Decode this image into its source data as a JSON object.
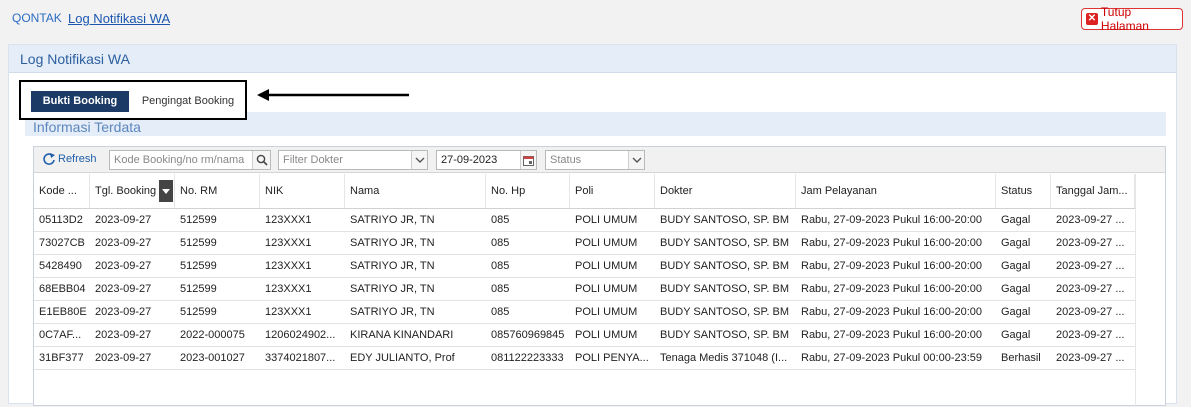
{
  "breadcrumb": {
    "app": "QONTAK",
    "page": "Log Notifikasi WA"
  },
  "close_button": {
    "label": "Tutup Halaman"
  },
  "panel": {
    "title": "Log Notifikasi WA"
  },
  "tabs": [
    {
      "label": "Bukti Booking",
      "active": true
    },
    {
      "label": "Pengingat Booking",
      "active": false
    }
  ],
  "section": {
    "title": "Informasi Terdata"
  },
  "toolbar": {
    "refresh_label": "Refresh",
    "search_placeholder": "Kode Booking/no rm/nama",
    "doctor_placeholder": "Filter Dokter",
    "date_value": "27-09-2023",
    "status_placeholder": "Status"
  },
  "columns": [
    "Kode ...",
    "Tgl. Booking",
    "No. RM",
    "NIK",
    "Nama",
    "No. Hp",
    "Poli",
    "Dokter",
    "Jam Pelayanan",
    "Status",
    "Tanggal Jam..."
  ],
  "rows": [
    [
      "05113D2",
      "2023-09-27",
      "512599",
      "123XXX1",
      "SATRIYO JR, TN",
      "085",
      "POLI UMUM",
      "BUDY SANTOSO, SP. BM",
      "Rabu, 27-09-2023 Pukul 16:00-20:00",
      "Gagal",
      "2023-09-27 ..."
    ],
    [
      "73027CB",
      "2023-09-27",
      "512599",
      "123XXX1",
      "SATRIYO JR, TN",
      "085",
      "POLI UMUM",
      "BUDY SANTOSO, SP. BM",
      "Rabu, 27-09-2023 Pukul 16:00-20:00",
      "Gagal",
      "2023-09-27 ..."
    ],
    [
      "5428490",
      "2023-09-27",
      "512599",
      "123XXX1",
      "SATRIYO JR, TN",
      "085",
      "POLI UMUM",
      "BUDY SANTOSO, SP. BM",
      "Rabu, 27-09-2023 Pukul 16:00-20:00",
      "Gagal",
      "2023-09-27 ..."
    ],
    [
      "68EBB04",
      "2023-09-27",
      "512599",
      "123XXX1",
      "SATRIYO JR, TN",
      "085",
      "POLI UMUM",
      "BUDY SANTOSO, SP. BM",
      "Rabu, 27-09-2023 Pukul 16:00-20:00",
      "Gagal",
      "2023-09-27 ..."
    ],
    [
      "E1EB80E",
      "2023-09-27",
      "512599",
      "123XXX1",
      "SATRIYO JR, TN",
      "085",
      "POLI UMUM",
      "BUDY SANTOSO, SP. BM",
      "Rabu, 27-09-2023 Pukul 16:00-20:00",
      "Gagal",
      "2023-09-27 ..."
    ],
    [
      "0C7AF...",
      "2023-09-27",
      "2022-000075",
      "1206024902...",
      "KIRANA KINANDARI",
      "085760969845",
      "POLI UMUM",
      "BUDY SANTOSO, SP. BM",
      "Rabu, 27-09-2023 Pukul 16:00-20:00",
      "Gagal",
      "2023-09-27 ..."
    ],
    [
      "31BF377",
      "2023-09-27",
      "2023-001027",
      "3374021807...",
      "EDY JULIANTO, Prof",
      "081122223333",
      "POLI PENYA...",
      "Tenaga Medis 371048 (I...",
      "Rabu, 27-09-2023 Pukul 00:00-23:59",
      "Berhasil",
      "2023-09-27 ..."
    ]
  ],
  "colors": {
    "accent": "#1b3a66",
    "link": "#1a56b0",
    "danger": "#cc0000",
    "header_bg": "#e4edf8"
  },
  "icons": [
    "close-icon",
    "arrow-left-icon",
    "refresh-icon",
    "search-icon",
    "chevron-down-icon",
    "calendar-icon",
    "sort-icon"
  ]
}
